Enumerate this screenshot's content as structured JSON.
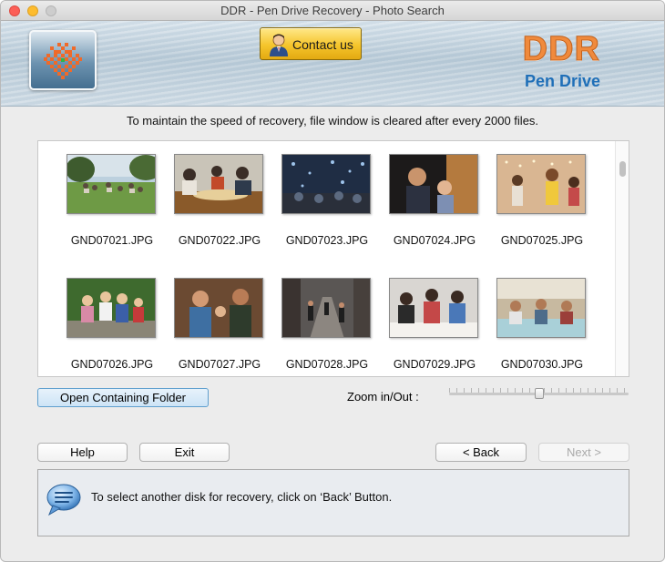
{
  "window": {
    "title": "DDR - Pen Drive Recovery - Photo Search"
  },
  "banner": {
    "contact_label": "Contact us",
    "brand": "DDR",
    "product": "Pen Drive"
  },
  "info_message": "To maintain the speed of recovery, file window is cleared after every 2000 files.",
  "files": [
    "GND07021.JPG",
    "GND07022.JPG",
    "GND07023.JPG",
    "GND07024.JPG",
    "GND07025.JPG",
    "GND07026.JPG",
    "GND07027.JPG",
    "GND07028.JPG",
    "GND07029.JPG",
    "GND07030.JPG"
  ],
  "actions": {
    "open_folder": "Open Containing Folder",
    "zoom_label": "Zoom in/Out :",
    "help": "Help",
    "exit": "Exit",
    "back": "< Back",
    "next": "Next >"
  },
  "status_message": "To select another disk for recovery, click on ‘Back’ Button.",
  "colors": {
    "brand_orange": "#f08a3c",
    "brand_blue": "#1f6fb8",
    "contact_gold": "#f5c52c"
  }
}
